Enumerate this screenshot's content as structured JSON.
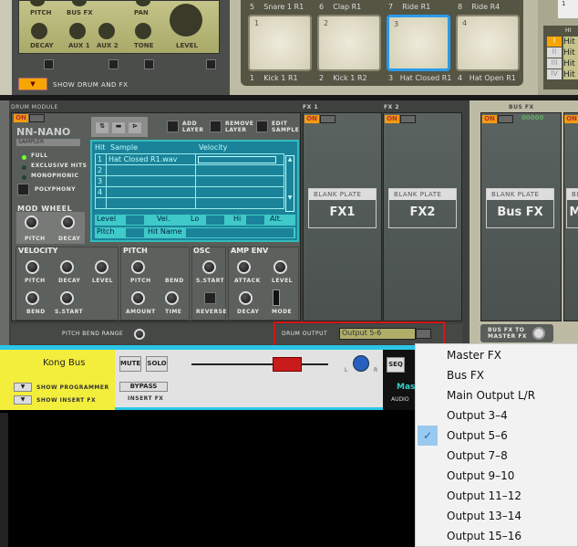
{
  "kong_top": {
    "knobs": [
      "PITCH",
      "BUS FX",
      "PAN",
      "DECAY",
      "AUX 1",
      "AUX 2",
      "TONE",
      "LEVEL"
    ],
    "show_drum_fx": "SHOW DRUM AND FX"
  },
  "pads": {
    "top_row": [
      {
        "num": "5",
        "label": "Snare 1 R1"
      },
      {
        "num": "6",
        "label": "Clap R1"
      },
      {
        "num": "7",
        "label": "Ride R1"
      },
      {
        "num": "8",
        "label": "Ride R4"
      }
    ],
    "bottom_row": [
      {
        "num": "1",
        "label": "Kick 1 R1"
      },
      {
        "num": "2",
        "label": "Kick 1 R2"
      },
      {
        "num": "3",
        "label": "Hat Closed R1",
        "selected": true
      },
      {
        "num": "4",
        "label": "Hat Open R1"
      }
    ]
  },
  "hit_selector": {
    "corner_nums": [
      "5",
      "1"
    ],
    "title": "HI",
    "items": [
      {
        "roman": "I",
        "text": "Hit",
        "active": true
      },
      {
        "roman": "II",
        "text": "Hit"
      },
      {
        "roman": "III",
        "text": "Hit"
      },
      {
        "roman": "IV",
        "text": "Hit"
      }
    ]
  },
  "drum_module": {
    "title": "DRUM MODULE",
    "on": "ON",
    "brand": "NN-NANO",
    "brand_sub": "SAMPLER",
    "modes": [
      "FULL",
      "EXCLUSIVE HITS",
      "MONOPHONIC"
    ],
    "polyphony": "POLYPHONY",
    "buttons": {
      "add": "ADD LAYER",
      "remove": "REMOVE LAYER",
      "edit": "EDIT SAMPLE"
    },
    "table": {
      "headers": [
        "Hit",
        "Sample",
        "Velocity"
      ],
      "rows": [
        {
          "hit": "1",
          "sample": "Hat Closed R1.wav"
        },
        {
          "hit": "2",
          "sample": ""
        },
        {
          "hit": "3",
          "sample": ""
        },
        {
          "hit": "4",
          "sample": ""
        }
      ]
    },
    "fields": {
      "level": "Level",
      "vel": "Vel.",
      "lo": "Lo",
      "hi": "Hi",
      "alt": "Alt.",
      "pitch": "Pitch",
      "hit_name": "Hit Name"
    },
    "mod_wheel": {
      "title": "MOD WHEEL",
      "knobs": [
        "PITCH",
        "DECAY"
      ]
    },
    "velocity": {
      "title": "VELOCITY",
      "knobs": [
        "PITCH",
        "DECAY",
        "LEVEL",
        "BEND",
        "S.START"
      ]
    },
    "pitch": {
      "title": "PITCH",
      "knobs": [
        "PITCH",
        "BEND",
        "AMOUNT",
        "TIME"
      ]
    },
    "osc": {
      "title": "OSC",
      "knobs": [
        "S.START",
        "REVERSE"
      ]
    },
    "amp_env": {
      "title": "AMP ENV",
      "knobs": [
        "ATTACK",
        "LEVEL",
        "DECAY",
        "MODE"
      ]
    },
    "pitch_bend_range": "PITCH BEND RANGE",
    "drum_output_label": "DRUM OUTPUT",
    "drum_output_value": "Output 5-6"
  },
  "fx": [
    {
      "title": "FX 1",
      "plate": "BLANK PLATE",
      "name": "FX1"
    },
    {
      "title": "FX 2",
      "plate": "BLANK PLATE",
      "name": "FX2"
    }
  ],
  "bus_fx": {
    "title": "BUS FX",
    "plate": "BLANK PLATE",
    "name": "Bus FX",
    "leds": "00000",
    "to_master": "BUS FX TO MASTER FX",
    "next_plate": "BL",
    "next_name": "M"
  },
  "mixer": {
    "channel": "Kong Bus",
    "show_programmer": "SHOW PROGRAMMER",
    "show_insert_fx": "SHOW INSERT FX",
    "mute": "MUTE",
    "solo": "SOLO",
    "bypass": "BYPASS",
    "insert_fx": "INSERT FX",
    "pan_l": "L",
    "pan_r": "R",
    "seq": "SEQ",
    "master": "Mas",
    "audio": "AUDIO"
  },
  "dropdown": {
    "items": [
      "Master FX",
      "Bus FX",
      "Main Output L/R",
      "Output 3–4",
      "Output 5–6",
      "Output 7–8",
      "Output 9–10",
      "Output 11–12",
      "Output 13–14",
      "Output 15–16"
    ],
    "checked": "Output 5–6"
  },
  "colors": {
    "accent_orange": "#f59b10",
    "highlight_red": "#d01818",
    "lcd": "#1a8aa0",
    "mixer_yellow": "#f3ee3c",
    "check_bg": "#99c9ef"
  }
}
